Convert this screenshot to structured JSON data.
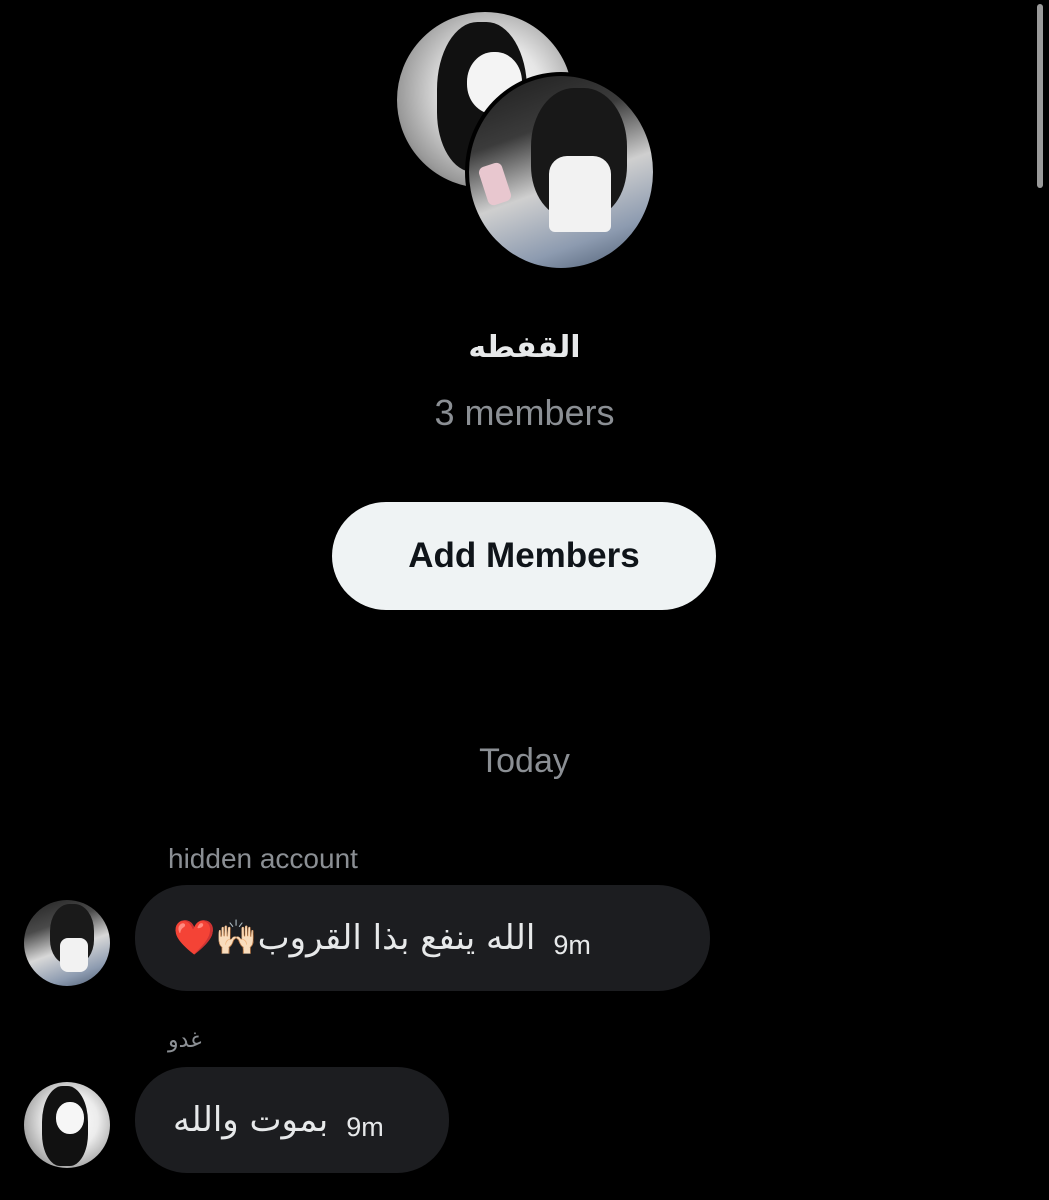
{
  "group": {
    "name": "القفطه",
    "member_count": "3 members",
    "add_members_label": "Add Members"
  },
  "conversation": {
    "day_divider": "Today",
    "messages": [
      {
        "sender": "hidden account",
        "text": "الله ينفع بذا القروب🙌🏻❤️",
        "time": "9m",
        "avatar_icon": "user-avatar-photo"
      },
      {
        "sender": "غدو",
        "text": "بموت والله",
        "time": "9m",
        "avatar_icon": "user-avatar-anime"
      }
    ]
  },
  "colors": {
    "background": "#000000",
    "bubble": "#1c1d20",
    "button_bg": "#eff3f4",
    "muted_text": "#8b8f94",
    "primary_text": "#e7e9ea"
  }
}
